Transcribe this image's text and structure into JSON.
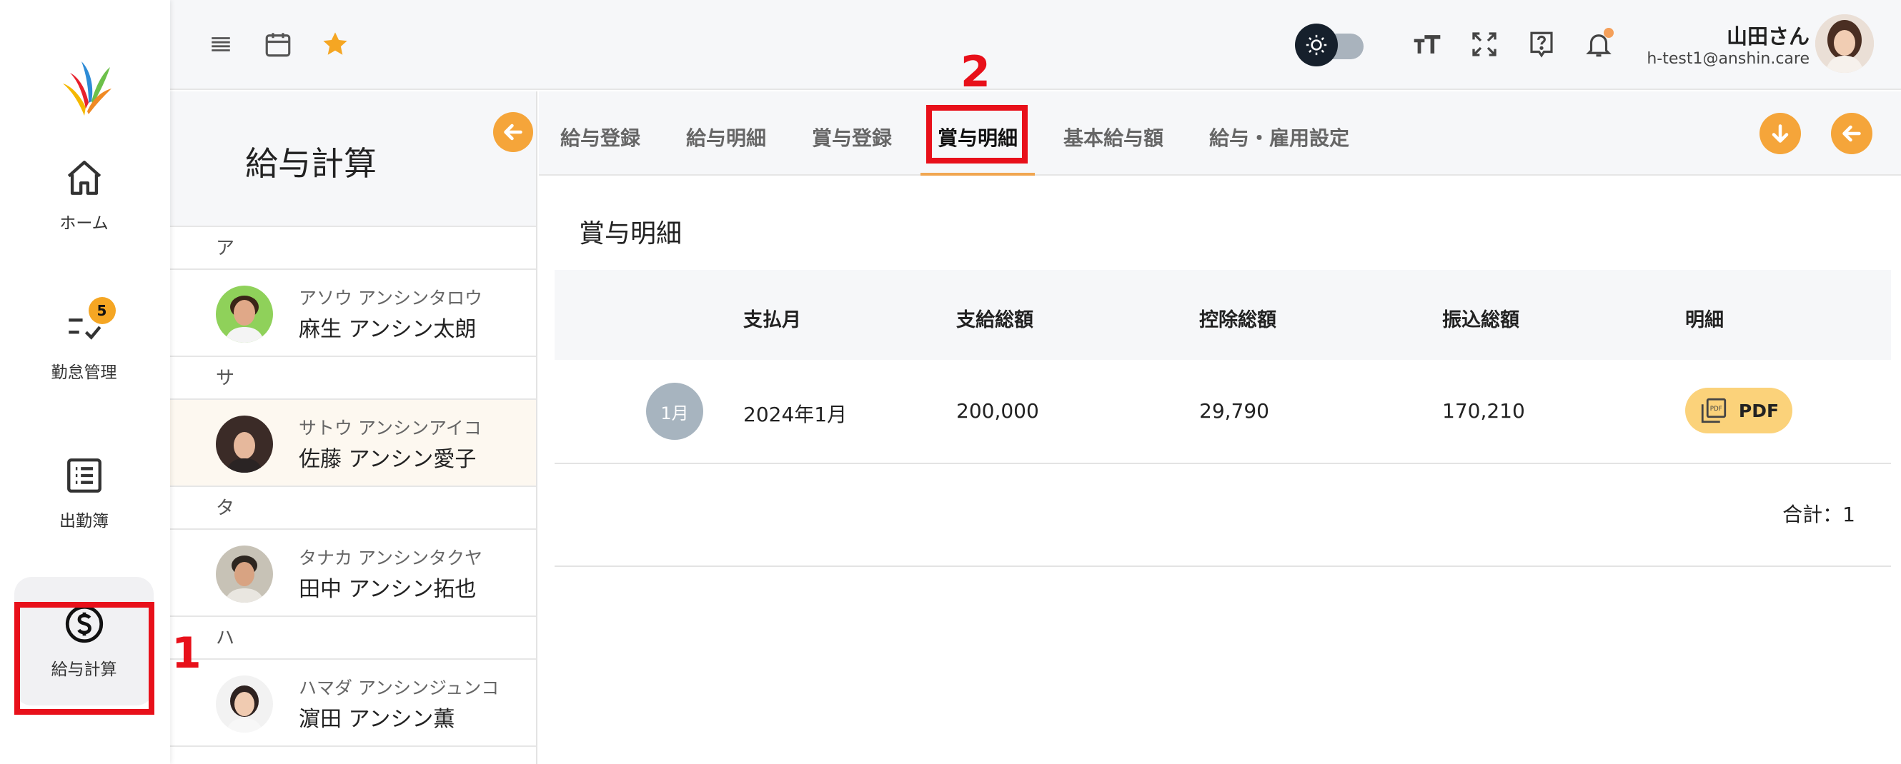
{
  "nav": {
    "items": [
      {
        "label": "ホーム",
        "icon": "home-icon"
      },
      {
        "label": "勤怠管理",
        "icon": "checklist-icon",
        "badge": "5"
      },
      {
        "label": "出勤簿",
        "icon": "list-icon"
      },
      {
        "label": "給与計算",
        "icon": "dollar-circle-icon"
      }
    ]
  },
  "user": {
    "name": "山田さん",
    "email": "h-test1@anshin.care"
  },
  "employee_panel": {
    "title": "給与計算",
    "groups": [
      {
        "letter": "ア",
        "employees": [
          {
            "kana": "アソウ アンシンタロウ",
            "name": "麻生 アンシン太朗"
          }
        ]
      },
      {
        "letter": "サ",
        "employees": [
          {
            "kana": "サトウ アンシンアイコ",
            "name": "佐藤 アンシン愛子"
          }
        ]
      },
      {
        "letter": "タ",
        "employees": [
          {
            "kana": "タナカ アンシンタクヤ",
            "name": "田中 アンシン拓也"
          }
        ]
      },
      {
        "letter": "ハ",
        "employees": [
          {
            "kana": "ハマダ アンシンジュンコ",
            "name": "濵田 アンシン薫"
          }
        ]
      }
    ],
    "selected": "佐藤 アンシン愛子"
  },
  "tabs": [
    "給与登録",
    "給与明細",
    "賞与登録",
    "賞与明細",
    "基本給与額",
    "給与・雇用設定"
  ],
  "active_tab": "賞与明細",
  "section_title": "賞与明細",
  "table": {
    "headers": [
      "支払月",
      "支給総額",
      "控除総額",
      "振込総額",
      "明細"
    ],
    "rows": [
      {
        "month_badge": "1月",
        "pay_month": "2024年1月",
        "gross": "200,000",
        "deduction": "29,790",
        "net": "170,210",
        "detail": "PDF"
      }
    ],
    "total": "合計：1"
  },
  "annotations": {
    "step1": "1",
    "step2": "2"
  },
  "colors": {
    "accent": "#f5a53a",
    "mark": "#e8101a",
    "badge": "#f5a623"
  }
}
